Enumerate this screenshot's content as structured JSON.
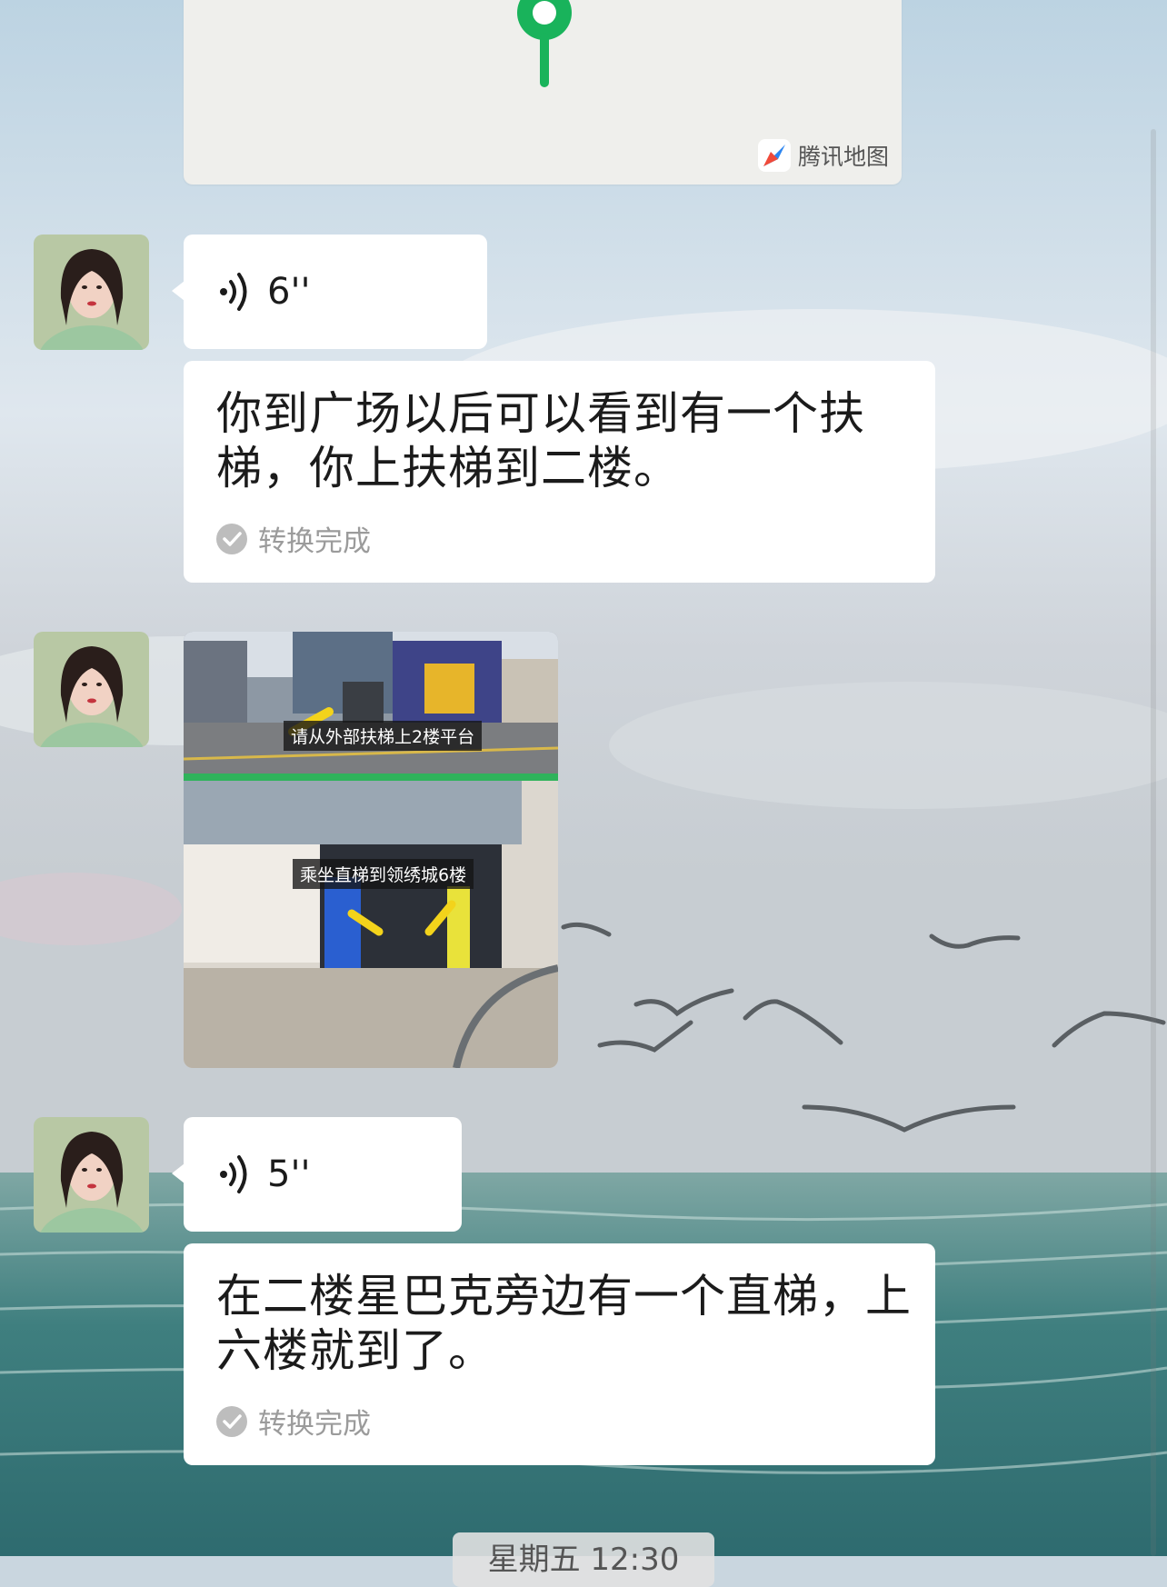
{
  "map": {
    "brand_label": "腾讯地图",
    "pin_color": "#19b35b"
  },
  "messages": [
    {
      "kind": "voice",
      "duration": "6''"
    },
    {
      "kind": "voice_transcript",
      "text": "你到广场以后可以看到有一个扶梯，你上扶梯到二楼。",
      "status": "转换完成"
    },
    {
      "kind": "image",
      "captions": [
        "请从外部扶梯上2楼平台",
        "乘坐直梯到领绣城6楼"
      ]
    },
    {
      "kind": "voice",
      "duration": "5''"
    },
    {
      "kind": "voice_transcript",
      "text": "在二楼星巴克旁边有一个直梯，上六楼就到了。",
      "status": "转换完成"
    }
  ],
  "timestamp": "星期五 12:30",
  "colors": {
    "bubble": "#ffffff",
    "status_text": "#9b9b9b",
    "accent_green": "#19b35b"
  }
}
